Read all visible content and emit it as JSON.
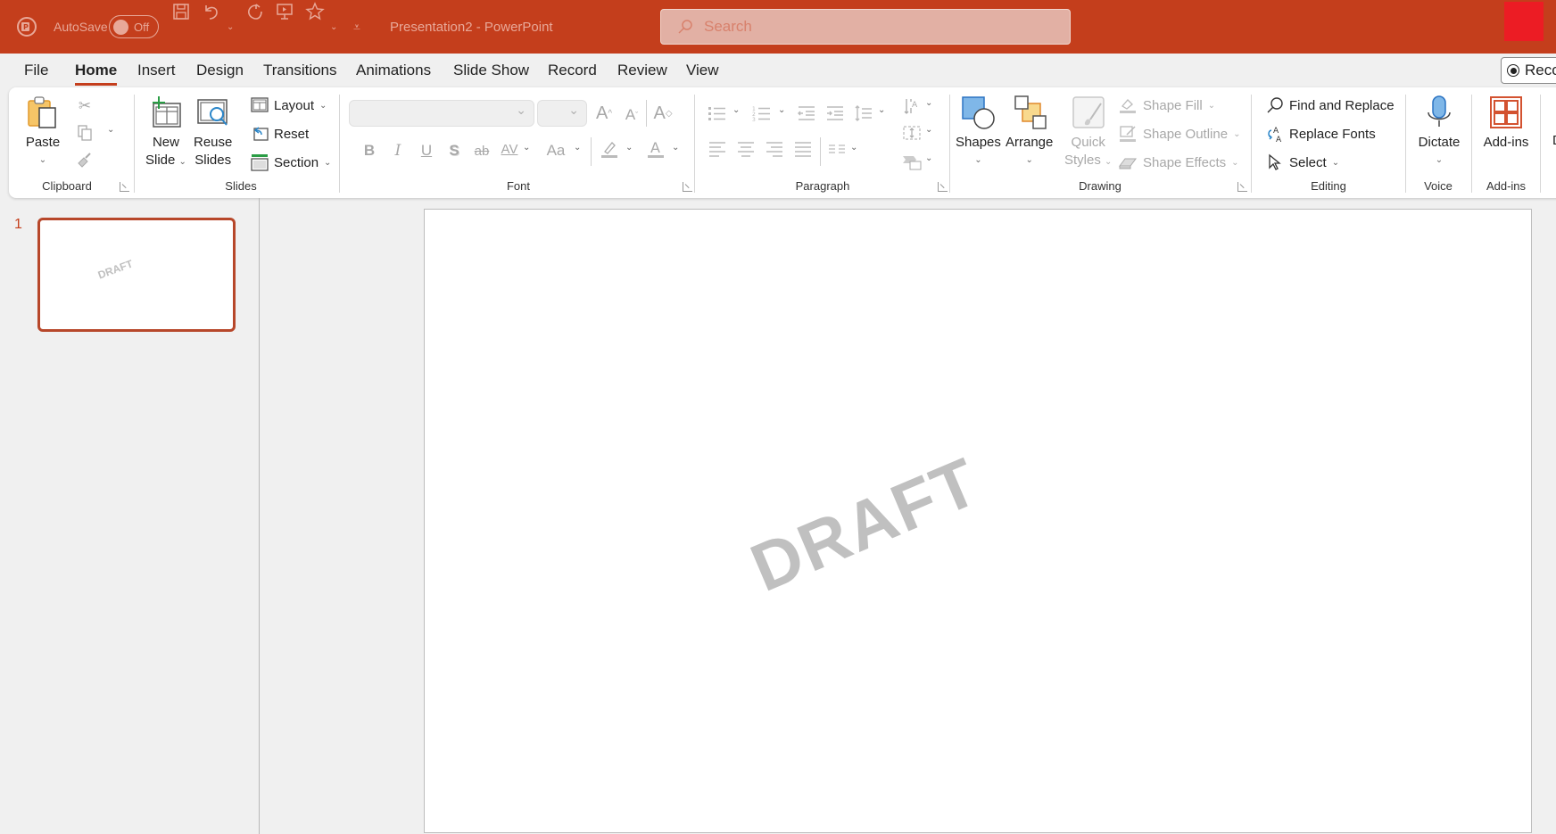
{
  "titlebar": {
    "autosave_label": "AutoSave",
    "autosave_state": "Off",
    "document_title": "Presentation2  -  PowerPoint",
    "search_placeholder": "Search",
    "colors": {
      "bar": "#c43e1c",
      "accent_box": "#ec1c24"
    }
  },
  "tabs": [
    {
      "label": "File"
    },
    {
      "label": "Home",
      "active": true
    },
    {
      "label": "Insert"
    },
    {
      "label": "Design"
    },
    {
      "label": "Transitions"
    },
    {
      "label": "Animations"
    },
    {
      "label": "Slide Show"
    },
    {
      "label": "Record"
    },
    {
      "label": "Review"
    },
    {
      "label": "View"
    }
  ],
  "record_button": "Reco",
  "ribbon": {
    "clipboard": {
      "label": "Clipboard",
      "paste": "Paste"
    },
    "slides": {
      "label": "Slides",
      "new_slide_1": "New",
      "new_slide_2": "Slide",
      "reuse_1": "Reuse",
      "reuse_2": "Slides",
      "layout": "Layout",
      "reset": "Reset",
      "section": "Section"
    },
    "font": {
      "label": "Font",
      "font_name": "",
      "font_size": "",
      "bold": "B",
      "italic": "I",
      "underline": "U",
      "shadow": "S",
      "strike": "ab",
      "spacing": "AV",
      "case": "Aa"
    },
    "paragraph": {
      "label": "Paragraph"
    },
    "drawing": {
      "label": "Drawing",
      "shapes": "Shapes",
      "arrange": "Arrange",
      "quick_1": "Quick",
      "quick_2": "Styles",
      "shape_fill": "Shape Fill",
      "shape_outline": "Shape Outline",
      "shape_effects": "Shape Effects"
    },
    "editing": {
      "label": "Editing",
      "find_replace": "Find and Replace",
      "replace_fonts": "Replace Fonts",
      "select": "Select"
    },
    "voice": {
      "label": "Voice",
      "dictate": "Dictate"
    },
    "addins": {
      "label": "Add-ins",
      "addins_btn": "Add-ins"
    },
    "cut_off": "De"
  },
  "thumbnails": [
    {
      "number": "1",
      "text": "DRAFT",
      "selected": true
    }
  ],
  "slide": {
    "watermark": "DRAFT"
  }
}
